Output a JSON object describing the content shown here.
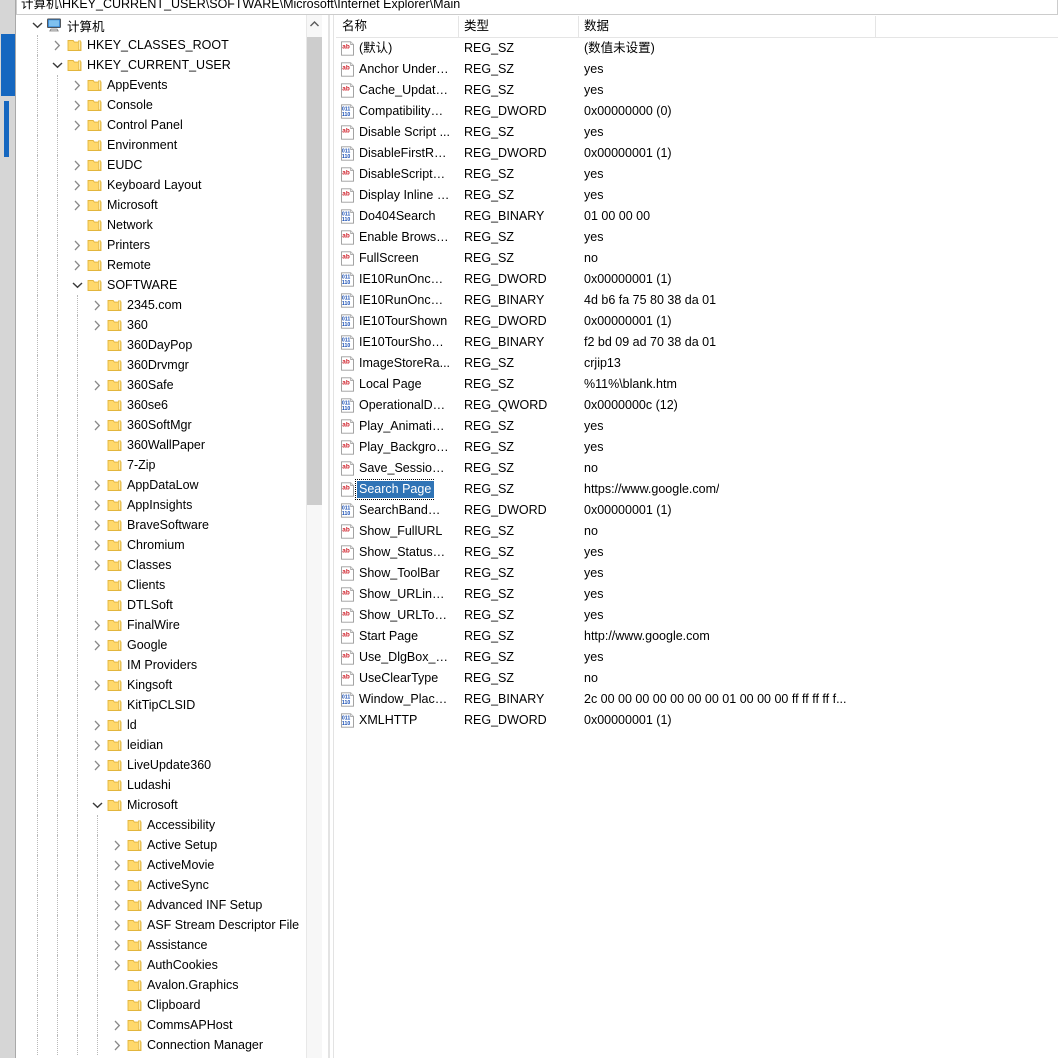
{
  "window": {
    "address_path": "计算机\\HKEY_CURRENT_USER\\SOFTWARE\\Microsoft\\Internet Explorer\\Main"
  },
  "tree": {
    "root_icon": "computer-icon",
    "nodes": [
      {
        "label": "计算机",
        "depth": 0,
        "icon": "computer-icon",
        "twisty": "expanded"
      },
      {
        "label": "HKEY_CLASSES_ROOT",
        "depth": 1,
        "icon": "folder-icon",
        "twisty": "collapsed"
      },
      {
        "label": "HKEY_CURRENT_USER",
        "depth": 1,
        "icon": "folder-icon",
        "twisty": "expanded"
      },
      {
        "label": "AppEvents",
        "depth": 2,
        "icon": "folder-icon",
        "twisty": "collapsed"
      },
      {
        "label": "Console",
        "depth": 2,
        "icon": "folder-icon",
        "twisty": "collapsed"
      },
      {
        "label": "Control Panel",
        "depth": 2,
        "icon": "folder-icon",
        "twisty": "collapsed"
      },
      {
        "label": "Environment",
        "depth": 2,
        "icon": "folder-icon",
        "twisty": "leaf"
      },
      {
        "label": "EUDC",
        "depth": 2,
        "icon": "folder-icon",
        "twisty": "collapsed"
      },
      {
        "label": "Keyboard Layout",
        "depth": 2,
        "icon": "folder-icon",
        "twisty": "collapsed"
      },
      {
        "label": "Microsoft",
        "depth": 2,
        "icon": "folder-icon",
        "twisty": "collapsed"
      },
      {
        "label": "Network",
        "depth": 2,
        "icon": "folder-icon",
        "twisty": "leaf"
      },
      {
        "label": "Printers",
        "depth": 2,
        "icon": "folder-icon",
        "twisty": "collapsed"
      },
      {
        "label": "Remote",
        "depth": 2,
        "icon": "folder-icon",
        "twisty": "collapsed"
      },
      {
        "label": "SOFTWARE",
        "depth": 2,
        "icon": "folder-icon",
        "twisty": "expanded"
      },
      {
        "label": "2345.com",
        "depth": 3,
        "icon": "folder-icon",
        "twisty": "collapsed"
      },
      {
        "label": "360",
        "depth": 3,
        "icon": "folder-icon",
        "twisty": "collapsed"
      },
      {
        "label": "360DayPop",
        "depth": 3,
        "icon": "folder-icon",
        "twisty": "leaf"
      },
      {
        "label": "360Drvmgr",
        "depth": 3,
        "icon": "folder-icon",
        "twisty": "leaf"
      },
      {
        "label": "360Safe",
        "depth": 3,
        "icon": "folder-icon",
        "twisty": "collapsed"
      },
      {
        "label": "360se6",
        "depth": 3,
        "icon": "folder-icon",
        "twisty": "leaf"
      },
      {
        "label": "360SoftMgr",
        "depth": 3,
        "icon": "folder-icon",
        "twisty": "collapsed"
      },
      {
        "label": "360WallPaper",
        "depth": 3,
        "icon": "folder-icon",
        "twisty": "leaf"
      },
      {
        "label": "7-Zip",
        "depth": 3,
        "icon": "folder-icon",
        "twisty": "leaf"
      },
      {
        "label": "AppDataLow",
        "depth": 3,
        "icon": "folder-icon",
        "twisty": "collapsed"
      },
      {
        "label": "AppInsights",
        "depth": 3,
        "icon": "folder-icon",
        "twisty": "collapsed"
      },
      {
        "label": "BraveSoftware",
        "depth": 3,
        "icon": "folder-icon",
        "twisty": "collapsed"
      },
      {
        "label": "Chromium",
        "depth": 3,
        "icon": "folder-icon",
        "twisty": "collapsed"
      },
      {
        "label": "Classes",
        "depth": 3,
        "icon": "folder-icon",
        "twisty": "collapsed"
      },
      {
        "label": "Clients",
        "depth": 3,
        "icon": "folder-icon",
        "twisty": "leaf"
      },
      {
        "label": "DTLSoft",
        "depth": 3,
        "icon": "folder-icon",
        "twisty": "leaf"
      },
      {
        "label": "FinalWire",
        "depth": 3,
        "icon": "folder-icon",
        "twisty": "collapsed"
      },
      {
        "label": "Google",
        "depth": 3,
        "icon": "folder-icon",
        "twisty": "collapsed"
      },
      {
        "label": "IM Providers",
        "depth": 3,
        "icon": "folder-icon",
        "twisty": "leaf"
      },
      {
        "label": "Kingsoft",
        "depth": 3,
        "icon": "folder-icon",
        "twisty": "collapsed"
      },
      {
        "label": "KitTipCLSID",
        "depth": 3,
        "icon": "folder-icon",
        "twisty": "leaf"
      },
      {
        "label": "ld",
        "depth": 3,
        "icon": "folder-icon",
        "twisty": "collapsed"
      },
      {
        "label": "leidian",
        "depth": 3,
        "icon": "folder-icon",
        "twisty": "collapsed"
      },
      {
        "label": "LiveUpdate360",
        "depth": 3,
        "icon": "folder-icon",
        "twisty": "collapsed"
      },
      {
        "label": "Ludashi",
        "depth": 3,
        "icon": "folder-icon",
        "twisty": "leaf"
      },
      {
        "label": "Microsoft",
        "depth": 3,
        "icon": "folder-icon",
        "twisty": "expanded"
      },
      {
        "label": "Accessibility",
        "depth": 4,
        "icon": "folder-icon",
        "twisty": "leaf"
      },
      {
        "label": "Active Setup",
        "depth": 4,
        "icon": "folder-icon",
        "twisty": "collapsed"
      },
      {
        "label": "ActiveMovie",
        "depth": 4,
        "icon": "folder-icon",
        "twisty": "collapsed"
      },
      {
        "label": "ActiveSync",
        "depth": 4,
        "icon": "folder-icon",
        "twisty": "collapsed"
      },
      {
        "label": "Advanced INF Setup",
        "depth": 4,
        "icon": "folder-icon",
        "twisty": "collapsed"
      },
      {
        "label": "ASF Stream Descriptor File",
        "depth": 4,
        "icon": "folder-icon",
        "twisty": "collapsed"
      },
      {
        "label": "Assistance",
        "depth": 4,
        "icon": "folder-icon",
        "twisty": "collapsed"
      },
      {
        "label": "AuthCookies",
        "depth": 4,
        "icon": "folder-icon",
        "twisty": "collapsed"
      },
      {
        "label": "Avalon.Graphics",
        "depth": 4,
        "icon": "folder-icon",
        "twisty": "leaf"
      },
      {
        "label": "Clipboard",
        "depth": 4,
        "icon": "folder-icon",
        "twisty": "leaf"
      },
      {
        "label": "CommsAPHost",
        "depth": 4,
        "icon": "folder-icon",
        "twisty": "collapsed"
      },
      {
        "label": "Connection Manager",
        "depth": 4,
        "icon": "folder-icon",
        "twisty": "collapsed"
      }
    ]
  },
  "values": {
    "columns": [
      "名称",
      "类型",
      "数据"
    ],
    "rows": [
      {
        "name": "(默认)",
        "type": "REG_SZ",
        "data": "(数值未设置)",
        "icon": "string-value-icon",
        "selected": false
      },
      {
        "name": "Anchor Underli...",
        "type": "REG_SZ",
        "data": "yes",
        "icon": "string-value-icon",
        "selected": false
      },
      {
        "name": "Cache_Update...",
        "type": "REG_SZ",
        "data": "yes",
        "icon": "string-value-icon",
        "selected": false
      },
      {
        "name": "CompatibilityFl...",
        "type": "REG_DWORD",
        "data": "0x00000000 (0)",
        "icon": "binary-value-icon",
        "selected": false
      },
      {
        "name": "Disable Script ...",
        "type": "REG_SZ",
        "data": "yes",
        "icon": "string-value-icon",
        "selected": false
      },
      {
        "name": "DisableFirstRu...",
        "type": "REG_DWORD",
        "data": "0x00000001 (1)",
        "icon": "binary-value-icon",
        "selected": false
      },
      {
        "name": "DisableScriptD...",
        "type": "REG_SZ",
        "data": "yes",
        "icon": "string-value-icon",
        "selected": false
      },
      {
        "name": "Display Inline I...",
        "type": "REG_SZ",
        "data": "yes",
        "icon": "string-value-icon",
        "selected": false
      },
      {
        "name": "Do404Search",
        "type": "REG_BINARY",
        "data": "01 00 00 00",
        "icon": "binary-value-icon",
        "selected": false
      },
      {
        "name": "Enable Browse...",
        "type": "REG_SZ",
        "data": "yes",
        "icon": "string-value-icon",
        "selected": false
      },
      {
        "name": "FullScreen",
        "type": "REG_SZ",
        "data": "no",
        "icon": "string-value-icon",
        "selected": false
      },
      {
        "name": "IE10RunOnceL...",
        "type": "REG_DWORD",
        "data": "0x00000001 (1)",
        "icon": "binary-value-icon",
        "selected": false
      },
      {
        "name": "IE10RunOnceL...",
        "type": "REG_BINARY",
        "data": "4d b6 fa 75 80 38 da 01",
        "icon": "binary-value-icon",
        "selected": false
      },
      {
        "name": "IE10TourShown",
        "type": "REG_DWORD",
        "data": "0x00000001 (1)",
        "icon": "binary-value-icon",
        "selected": false
      },
      {
        "name": "IE10TourShow...",
        "type": "REG_BINARY",
        "data": "f2 bd 09 ad 70 38 da 01",
        "icon": "binary-value-icon",
        "selected": false
      },
      {
        "name": "ImageStoreRa...",
        "type": "REG_SZ",
        "data": "crjip13",
        "icon": "string-value-icon",
        "selected": false
      },
      {
        "name": "Local Page",
        "type": "REG_SZ",
        "data": "%11%\\blank.htm",
        "icon": "string-value-icon",
        "selected": false
      },
      {
        "name": "OperationalData",
        "type": "REG_QWORD",
        "data": "0x0000000c (12)",
        "icon": "binary-value-icon",
        "selected": false
      },
      {
        "name": "Play_Animations",
        "type": "REG_SZ",
        "data": "yes",
        "icon": "string-value-icon",
        "selected": false
      },
      {
        "name": "Play_Backgrou...",
        "type": "REG_SZ",
        "data": "yes",
        "icon": "string-value-icon",
        "selected": false
      },
      {
        "name": "Save_Session_...",
        "type": "REG_SZ",
        "data": "no",
        "icon": "string-value-icon",
        "selected": false
      },
      {
        "name": "Search Page",
        "type": "REG_SZ",
        "data": "https://www.google.com/",
        "icon": "string-value-icon",
        "selected": true
      },
      {
        "name": "SearchBandMi...",
        "type": "REG_DWORD",
        "data": "0x00000001 (1)",
        "icon": "binary-value-icon",
        "selected": false
      },
      {
        "name": "Show_FullURL",
        "type": "REG_SZ",
        "data": "no",
        "icon": "string-value-icon",
        "selected": false
      },
      {
        "name": "Show_StatusBar",
        "type": "REG_SZ",
        "data": "yes",
        "icon": "string-value-icon",
        "selected": false
      },
      {
        "name": "Show_ToolBar",
        "type": "REG_SZ",
        "data": "yes",
        "icon": "string-value-icon",
        "selected": false
      },
      {
        "name": "Show_URLinSta...",
        "type": "REG_SZ",
        "data": "yes",
        "icon": "string-value-icon",
        "selected": false
      },
      {
        "name": "Show_URLTool...",
        "type": "REG_SZ",
        "data": "yes",
        "icon": "string-value-icon",
        "selected": false
      },
      {
        "name": "Start Page",
        "type": "REG_SZ",
        "data": "http://www.google.com",
        "icon": "string-value-icon",
        "selected": false
      },
      {
        "name": "Use_DlgBox_C...",
        "type": "REG_SZ",
        "data": "yes",
        "icon": "string-value-icon",
        "selected": false
      },
      {
        "name": "UseClearType",
        "type": "REG_SZ",
        "data": "no",
        "icon": "string-value-icon",
        "selected": false
      },
      {
        "name": "Window_Place...",
        "type": "REG_BINARY",
        "data": "2c 00 00 00 00 00 00 00 01 00 00 00 ff ff ff ff f...",
        "icon": "binary-value-icon",
        "selected": false
      },
      {
        "name": "XMLHTTP",
        "type": "REG_DWORD",
        "data": "0x00000001 (1)",
        "icon": "binary-value-icon",
        "selected": false
      }
    ]
  },
  "colors": {
    "selection": "#3074b6",
    "folder": "#ffd86b",
    "scroll_accent": "#1567c0",
    "twisty": "#767676"
  }
}
